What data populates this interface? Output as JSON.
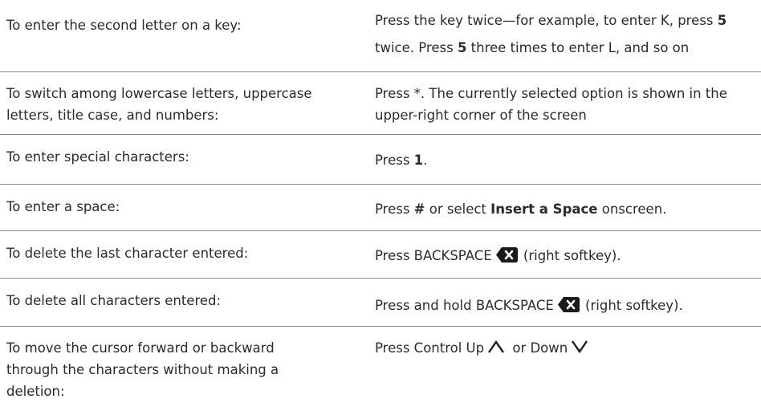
{
  "rows": [
    {
      "left": "To enter the second letter on a key:",
      "right": {
        "a": "Press the key twice—for example, to enter K, press ",
        "b": "5",
        "c": "twice. Press ",
        "d": "5",
        "e": " three times to enter L, and so on"
      }
    },
    {
      "left": "To switch among lowercase letters, uppercase letters, title case, and numbers:",
      "right": {
        "a": "Press *. The currently selected option is shown in the upper-right corner of the screen"
      }
    },
    {
      "left": "To enter special characters:",
      "right": {
        "a": "Press ",
        "b": "1",
        "c": "."
      }
    },
    {
      "left": "To enter a space:",
      "right": {
        "a": "Press ",
        "b": "#",
        "c": " or select ",
        "d": "Insert a Space",
        "e": " onscreen."
      }
    },
    {
      "left": "To delete the last character entered:",
      "right": {
        "a": "Press BACKSPACE",
        "icon": "backspace-icon",
        "b": " (right softkey)."
      }
    },
    {
      "left": "To delete all characters entered:",
      "right": {
        "a": "Press and hold BACKSPACE",
        "icon": "backspace-icon",
        "b": " (right softkey)."
      }
    },
    {
      "left": "To move the cursor forward or backward through the characters without making a deletion:",
      "right": {
        "a": "Press Control Up",
        "icon_up": "chevron-up-icon",
        "b": " or Down",
        "icon_down": "chevron-down-icon"
      }
    }
  ]
}
